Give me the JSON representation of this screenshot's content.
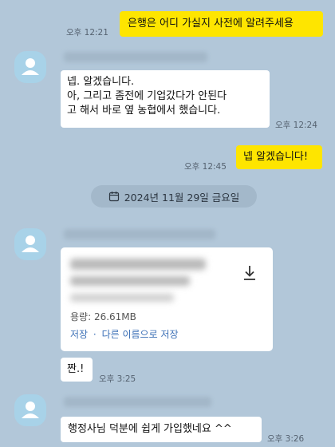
{
  "messages": {
    "m1": {
      "text": "은행은 어디 가실지 사전에 알려주세용",
      "time": "오후 12:21"
    },
    "m2": {
      "lines": [
        "넵. 알겠습니다.",
        "아, 그리고 좀전에 기업갔다가 안된다",
        "고 해서 바로 옆 농협에서 했습니다."
      ],
      "time": "오후 12:24"
    },
    "m3": {
      "text": "넵 알겠습니다!",
      "time": "오후 12:45"
    },
    "date_divider": "2024년 11월 29일 금요일",
    "file": {
      "size_label": "용량: 26.61MB",
      "save_label": "저장",
      "separator": "·",
      "save_as_label": "다른 이름으로 저장",
      "time": ""
    },
    "m5": {
      "text": "짠.!",
      "time": "오후 3:25"
    },
    "m6": {
      "text": "행정사님 덕분에 쉽게 가입했네요 ^^",
      "time": "오후 3:26"
    }
  },
  "icons": {
    "avatar": "person-icon",
    "download": "download-icon",
    "calendar": "calendar-icon"
  },
  "colors": {
    "background": "#b2c7d9",
    "my_bubble": "#fee500",
    "their_bubble": "#ffffff",
    "link": "#3b6fb6"
  }
}
